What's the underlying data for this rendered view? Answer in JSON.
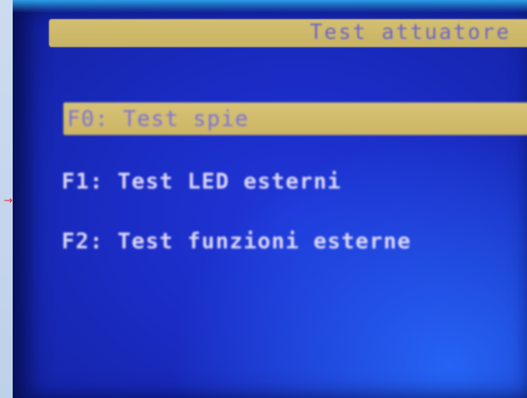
{
  "marker": {
    "glyph": "→"
  },
  "screen": {
    "title": "Test attuatore",
    "menu": [
      {
        "label": "F0: Test spie",
        "selected": true
      },
      {
        "label": "F1: Test LED esterni",
        "selected": false
      },
      {
        "label": "F2: Test funzioni esterne",
        "selected": false
      }
    ]
  },
  "colors": {
    "screen_background": "#1a2cc4",
    "highlight": "#d3bf72",
    "highlight_text": "#7a72d8",
    "menu_text": "#dcd8f6"
  }
}
